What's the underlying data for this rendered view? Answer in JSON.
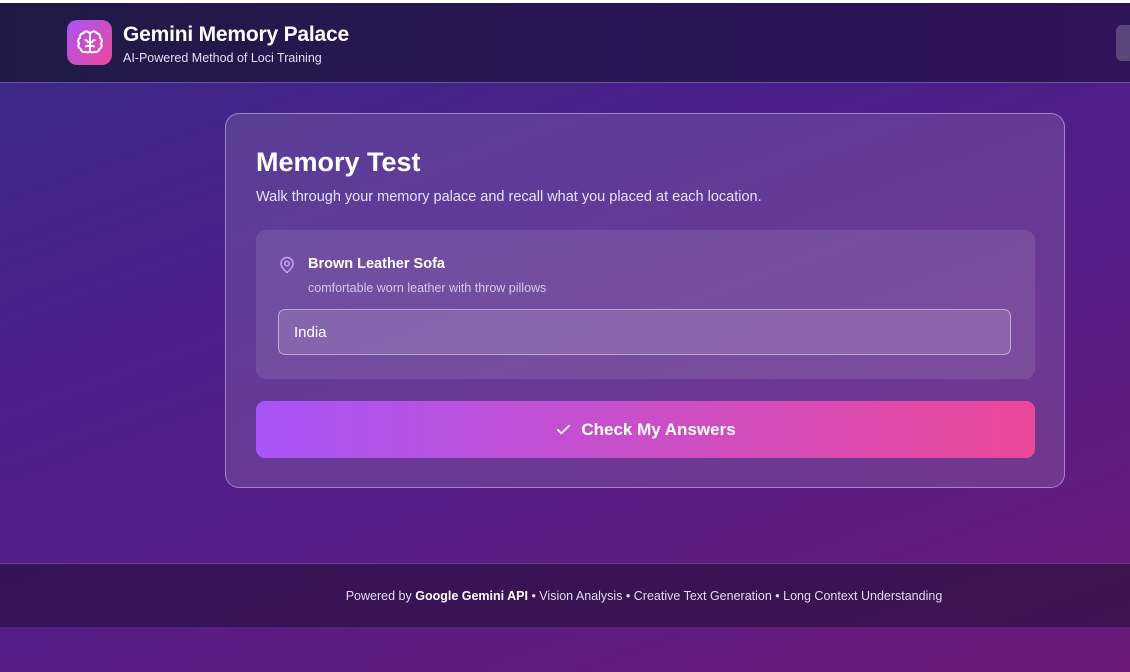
{
  "header": {
    "title": "Gemini Memory Palace",
    "subtitle": "AI-Powered Method of Loci Training",
    "logo_icon": "brain-icon"
  },
  "test": {
    "title": "Memory Test",
    "description": "Walk through your memory palace and recall what you placed at each location.",
    "location": {
      "icon": "map-pin-icon",
      "name": "Brown Leather Sofa",
      "description": "comfortable worn leather with throw pillows",
      "answer_value": "India"
    },
    "check_button": {
      "icon": "check-icon",
      "label": "Check My Answers"
    }
  },
  "footer": {
    "prefix": "Powered by",
    "brand": "Google Gemini API",
    "features": "• Vision Analysis • Creative Text Generation • Long Context Understanding"
  },
  "colors": {
    "accent_start": "#a855f7",
    "accent_end": "#ec4899"
  }
}
